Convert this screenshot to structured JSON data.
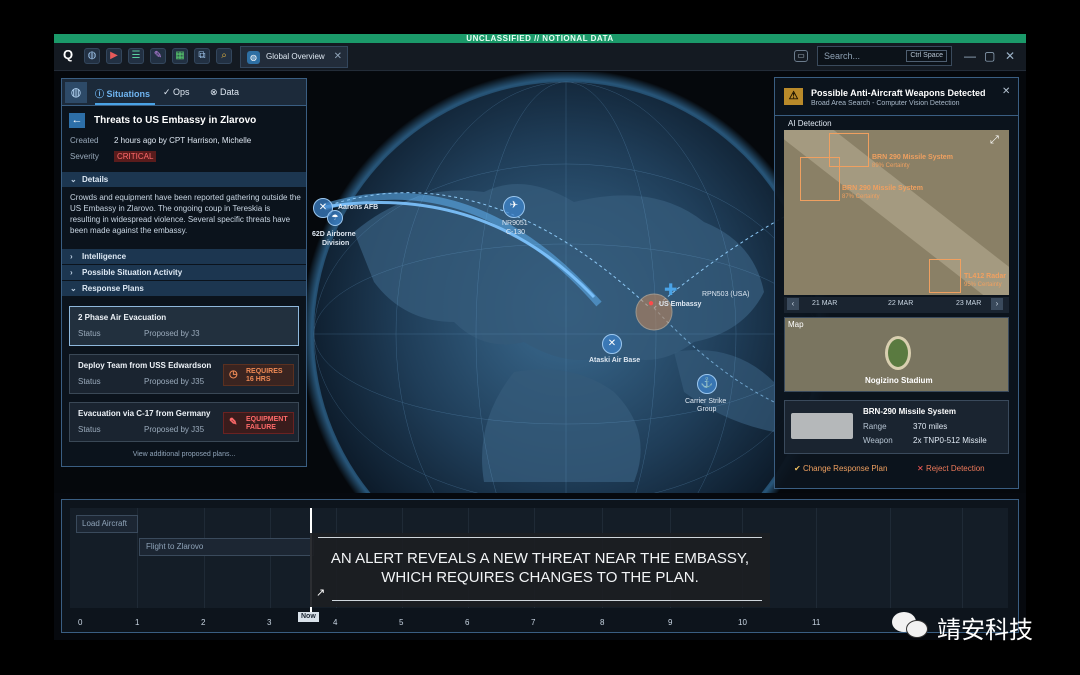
{
  "banner": "UNCLASSIFIED // NOTIONAL DATA",
  "toolbar": {
    "icons": [
      "app-logo-icon",
      "globe-icon",
      "video-icon",
      "list-icon",
      "pen-icon",
      "table-icon",
      "network-icon",
      "search-map-icon"
    ],
    "tab_label": "Global Overview",
    "search_placeholder": "Search...",
    "search_shortcut": "Ctrl Space"
  },
  "left": {
    "tabs": [
      "Situations",
      "Ops",
      "Data"
    ],
    "title": "Threats to US Embassy in Zlarovo",
    "created_label": "Created",
    "created_value": "2 hours ago by CPT Harrison, Michelle",
    "severity_label": "Severity",
    "severity_value": "CRITICAL",
    "details_label": "Details",
    "details_text": "Crowds and equipment have been reported gathering outside the US Embassy in Zlarovo. The ongoing coup in Tereskia is resulting in widespread violence. Several specific threats have been made against the embassy.",
    "sections": [
      "Intelligence",
      "Possible Situation Activity",
      "Response Plans"
    ],
    "plans": [
      {
        "name": "2 Phase Air Evacuation",
        "status_label": "Status",
        "status": "Proposed by J3",
        "badge": ""
      },
      {
        "name": "Deploy Team from USS Edwardson",
        "status_label": "Status",
        "status": "Proposed by J35",
        "badge_l1": "REQUIRES",
        "badge_l2": "16 HRS"
      },
      {
        "name": "Evacuation via C-17 from Germany",
        "status_label": "Status",
        "status": "Proposed by J35",
        "badge_l1": "EQUIPMENT",
        "badge_l2": "FAILURE"
      }
    ],
    "more": "View additional proposed plans..."
  },
  "map": {
    "labels": {
      "aarons": "Aarons AFB",
      "airborne_1": "62D Airborne",
      "airborne_2": "Division",
      "nr_1": "NR9051",
      "nr_2": "C-130",
      "rpn": "RPN503 (USA)",
      "embassy": "US Embassy",
      "ataski": "Ataski Air Base",
      "carrier_1": "Carrier Strike",
      "carrier_2": "Group"
    }
  },
  "right": {
    "title": "Possible Anti-Aircraft Weapons Detected",
    "subtitle": "Broad Area Search - Computer Vision Detection",
    "ai_label": "AI Detection",
    "detections": [
      {
        "name": "BRN 290 Missile System",
        "cert": "89% Certainty"
      },
      {
        "name": "BRN 290 Missile System",
        "cert": "87% Certainty"
      },
      {
        "name": "TL412 Radar",
        "cert": "95% Certainty"
      }
    ],
    "dates": [
      "21 MAR",
      "22 MAR",
      "23 MAR"
    ],
    "map_label": "Map",
    "stadium": "Nogizino Stadium",
    "system_name": "BRN-290 Missile System",
    "range_label": "Range",
    "range_value": "370 miles",
    "weapon_label": "Weapon",
    "weapon_value": "2x TNP0-512 Missile",
    "change_btn": "Change Response Plan",
    "reject_btn": "Reject Detection"
  },
  "timeline": {
    "bar1": "Load Aircraft",
    "bar2": "Flight to Zlarovo",
    "now": "Now",
    "ticks": [
      "0",
      "1",
      "2",
      "3",
      "4",
      "5",
      "6",
      "7",
      "8",
      "9",
      "10",
      "11"
    ]
  },
  "caption": {
    "line1": "AN ALERT REVEALS A NEW THREAT NEAR THE EMBASSY,",
    "line2": "WHICH REQUIRES CHANGES TO THE PLAN."
  },
  "watermark": "靖安科技",
  "colors": {
    "banner": "#1b9a6a",
    "critical": "#d94a4a",
    "accent": "#4aa3e6",
    "warning": "#ef8a55"
  }
}
